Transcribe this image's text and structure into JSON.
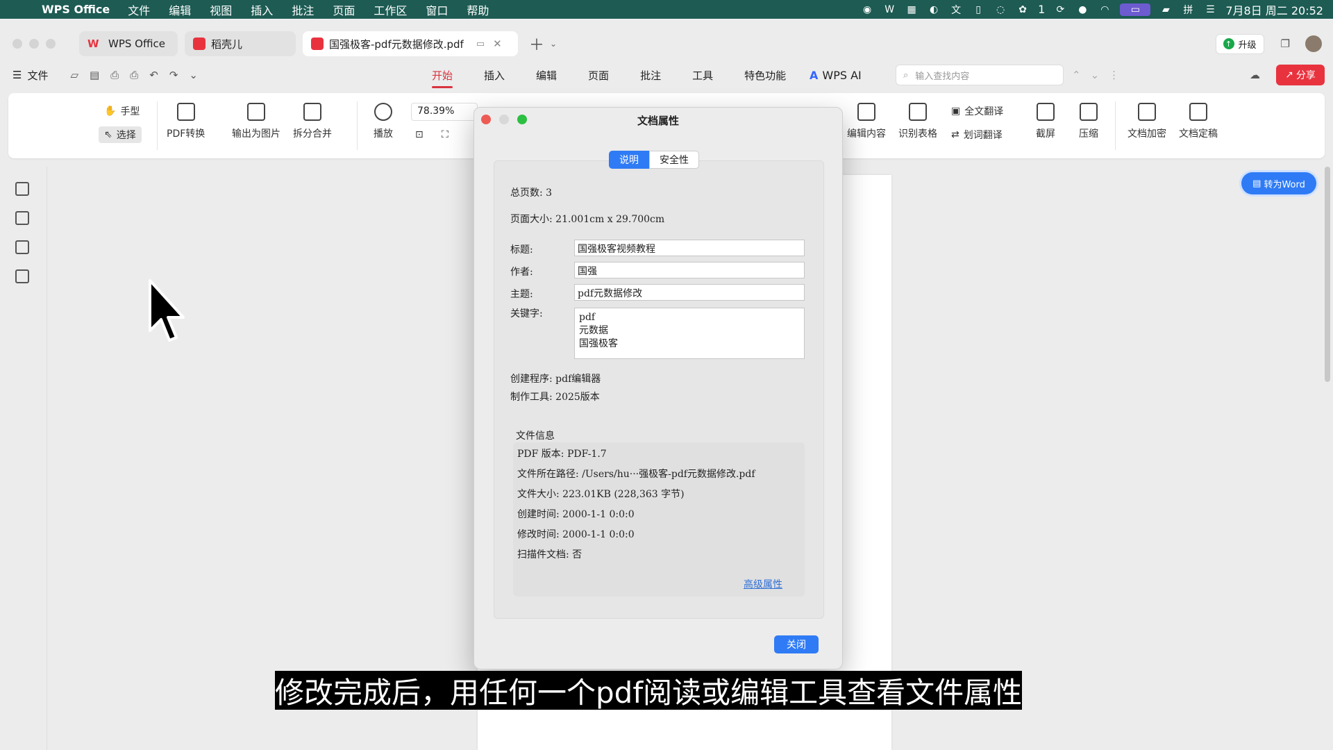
{
  "menubar": {
    "app_name": "WPS Office",
    "items": [
      "文件",
      "编辑",
      "视图",
      "插入",
      "批注",
      "页面",
      "工作区",
      "窗口",
      "帮助"
    ],
    "status_num": "1",
    "datetime": "7月8日 周二  20:52"
  },
  "tabs": {
    "wps": "WPS Office",
    "daoke": "稻壳儿",
    "pdf": "国强极客-pdf元数据修改.pdf",
    "upgrade": "升级"
  },
  "menurow": {
    "file": "文件",
    "ribbon_tabs": [
      "开始",
      "插入",
      "编辑",
      "页面",
      "批注",
      "工具",
      "特色功能"
    ],
    "wps_ai": "WPS AI",
    "search_placeholder": "输入查找内容",
    "share": "分享"
  },
  "ribbon": {
    "hand": "手型",
    "select": "选择",
    "pdf_convert": "PDF转换",
    "export_image": "输出为图片",
    "split_merge": "拆分合并",
    "play": "播放",
    "zoom": "78.39%",
    "edit_content": "编辑内容",
    "recognize_table": "识别表格",
    "full_translate": "全文翻译",
    "word_translate": "划词翻译",
    "screenshot": "截屏",
    "compress": "压缩",
    "encrypt": "文档加密",
    "finalize": "文档定稿"
  },
  "to_word": "转为Word",
  "dialog": {
    "title": "文档属性",
    "tab_desc": "说明",
    "tab_security": "安全性",
    "total_pages": "总页数: 3",
    "page_size": "页面大小: 21.001cm x 29.700cm",
    "title_label": "标题:",
    "title_value": "国强极客视频教程",
    "author_label": "作者:",
    "author_value": "国强",
    "subject_label": "主题:",
    "subject_value": "pdf元数据修改",
    "keywords_label": "关键字:",
    "keywords": [
      "pdf",
      "元数据",
      "国强极客"
    ],
    "creator": "创建程序:  pdf编辑器",
    "producer": "制作工具:  2025版本",
    "file_info_title": "文件信息",
    "file_info": [
      "PDF 版本: PDF-1.7",
      "文件所在路径: /Users/hu···强极客-pdf元数据修改.pdf",
      "文件大小: 223.01KB (228,363 字节)",
      "创建时间: 2000-1-1 0:0:0",
      "修改时间: 2000-1-1 0:0:0",
      "扫描件文档: 否"
    ],
    "advanced": "高级属性",
    "close": "关闭"
  },
  "subtitle": "修改完成后，用任何一个pdf阅读或编辑工具查看文件属性"
}
